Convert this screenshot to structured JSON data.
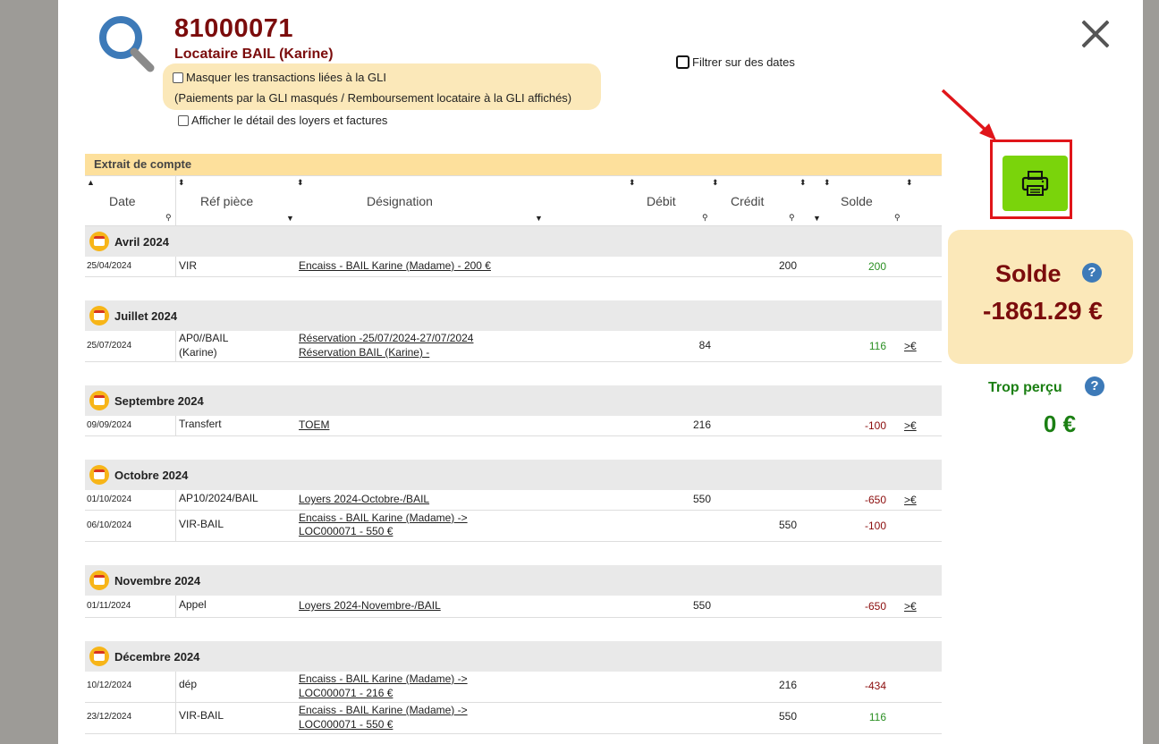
{
  "header": {
    "account_id": "81000071",
    "tenant_name": "Locataire BAIL (Karine)",
    "hide_gli_label": "Masquer les transactions liées à la GLI",
    "hide_gli_note": "(Paiements par la GLI masqués / Remboursement locataire à la GLI affichés)",
    "show_detail_label": "Afficher le détail des loyers et factures",
    "filter_dates_label": "Filtrer sur des dates"
  },
  "table": {
    "title": "Extrait de compte",
    "columns": {
      "date": "Date",
      "ref": "Réf pièce",
      "designation": "Désignation",
      "debit": "Débit",
      "credit": "Crédit",
      "solde": "Solde"
    },
    "months": [
      {
        "label": "Avril 2024",
        "rows": [
          {
            "date": "25/04/2024",
            "ref": "VIR",
            "des1": "Encaiss - BAIL Karine (Madame) - 200 €",
            "des2": "",
            "debit": "",
            "credit": "200",
            "solde": "200",
            "action": ""
          }
        ]
      },
      {
        "label": "Juillet 2024",
        "rows": [
          {
            "date": "25/07/2024",
            "ref": "AP0//BAIL (Karine)",
            "des1": "Réservation -25/07/2024-27/07/2024",
            "des2": "Réservation BAIL (Karine) -",
            "debit": "84",
            "credit": "",
            "solde": "116",
            "action": ">€"
          }
        ]
      },
      {
        "label": "Septembre 2024",
        "rows": [
          {
            "date": "09/09/2024",
            "ref": "Transfert",
            "des1": "TOEM",
            "des2": "",
            "debit": "216",
            "credit": "",
            "solde": "-100",
            "action": ">€"
          }
        ]
      },
      {
        "label": "Octobre 2024",
        "rows": [
          {
            "date": "01/10/2024",
            "ref": "AP10/2024/BAIL",
            "des1": "Loyers 2024-Octobre-/BAIL",
            "des2": "",
            "debit": "550",
            "credit": "",
            "solde": "-650",
            "action": ">€"
          },
          {
            "date": "06/10/2024",
            "ref": "VIR-BAIL",
            "des1": "Encaiss - BAIL Karine (Madame) ->",
            "des2": "LOC000071 - 550 €",
            "debit": "",
            "credit": "550",
            "solde": "-100",
            "action": ""
          }
        ]
      },
      {
        "label": "Novembre 2024",
        "rows": [
          {
            "date": "01/11/2024",
            "ref": "Appel",
            "des1": "Loyers 2024-Novembre-/BAIL",
            "des2": "",
            "debit": "550",
            "credit": "",
            "solde": "-650",
            "action": ">€"
          }
        ]
      },
      {
        "label": "Décembre 2024",
        "rows": [
          {
            "date": "10/12/2024",
            "ref": "dép",
            "des1": "Encaiss - BAIL Karine (Madame) ->",
            "des2": "LOC000071 - 216 €",
            "debit": "",
            "credit": "216",
            "solde": "-434",
            "action": ""
          },
          {
            "date": "23/12/2024",
            "ref": "VIR-BAIL",
            "des1": "Encaiss - BAIL Karine (Madame) ->",
            "des2": "LOC000071 - 550 €",
            "debit": "",
            "credit": "550",
            "solde": "116",
            "action": ""
          }
        ]
      }
    ]
  },
  "summary": {
    "solde_label": "Solde",
    "solde_value": "-1861.29 €",
    "trop_percu_label": "Trop perçu",
    "trop_percu_value": "0 €",
    "help_glyph": "?"
  },
  "icons": {
    "search": "search-icon",
    "close": "close-icon",
    "print": "printer-icon",
    "calendar": "calendar-icon"
  },
  "colors": {
    "brand_dark_red": "#7b0c0c",
    "highlight_yellow": "#fbe8b9",
    "print_green": "#7ad40b",
    "positive_green": "#2a8f22",
    "annotation_red": "#e0151a"
  }
}
